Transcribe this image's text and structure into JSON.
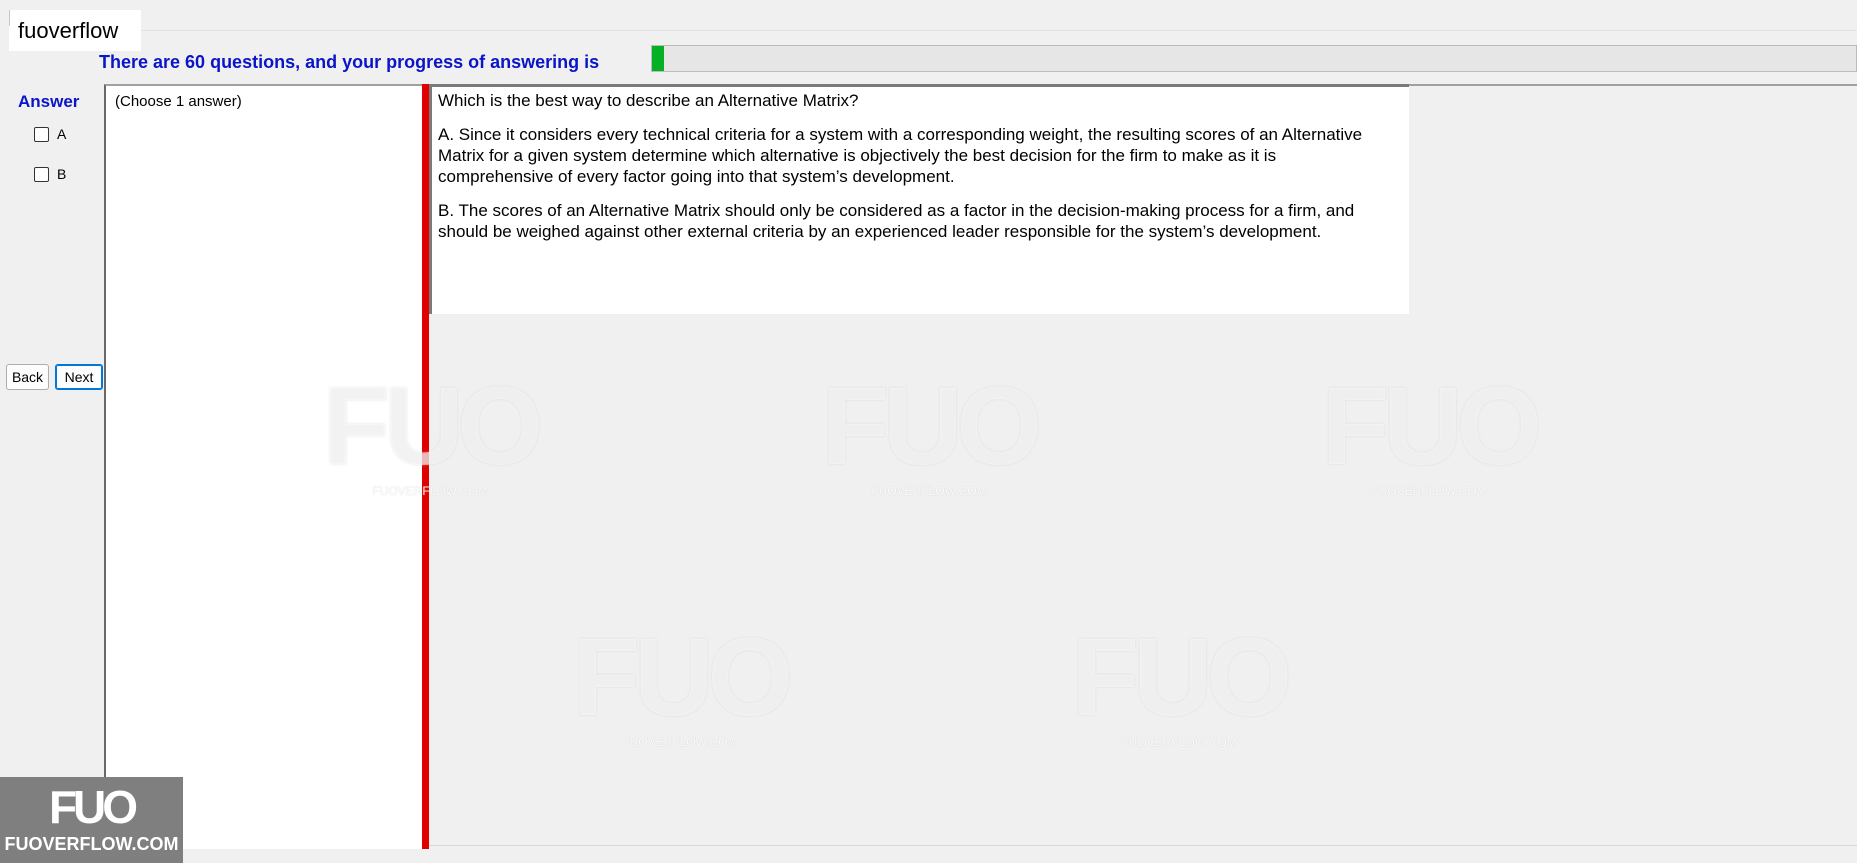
{
  "window": {
    "title": "fuoverflow"
  },
  "progress": {
    "label": "There are 60 questions, and your progress of answering is",
    "fraction": 0.01,
    "fill_color": "#06b025"
  },
  "answer": {
    "heading": "Answer",
    "options": [
      "A",
      "B"
    ]
  },
  "nav": {
    "back_label": "Back",
    "next_label": "Next"
  },
  "choice_panel": {
    "instruction": "(Choose 1 answer)"
  },
  "question": {
    "prompt": "Which is the best way to describe an Alternative Matrix?",
    "option_a": "A.  Since it considers every technical criteria for a system with a corresponding weight, the resulting scores of an Alternative Matrix for a given system determine which alternative is objectively the best decision for the firm to make as it is comprehensive of every factor going into that system’s development.",
    "option_b": "B.  The scores of an Alternative Matrix should only be considered as a factor in the decision-making process for a firm, and should be weighed against other external criteria by an experienced leader responsible for the system’s development."
  },
  "watermark": {
    "mark": "FUO",
    "site": "FUOVERFLOW.COM"
  },
  "brand": {
    "mark": "FUO",
    "site": "FUOVERFLOW.COM"
  },
  "colors": {
    "heading_blue": "#0a14c8",
    "divider_red": "#e00000"
  }
}
